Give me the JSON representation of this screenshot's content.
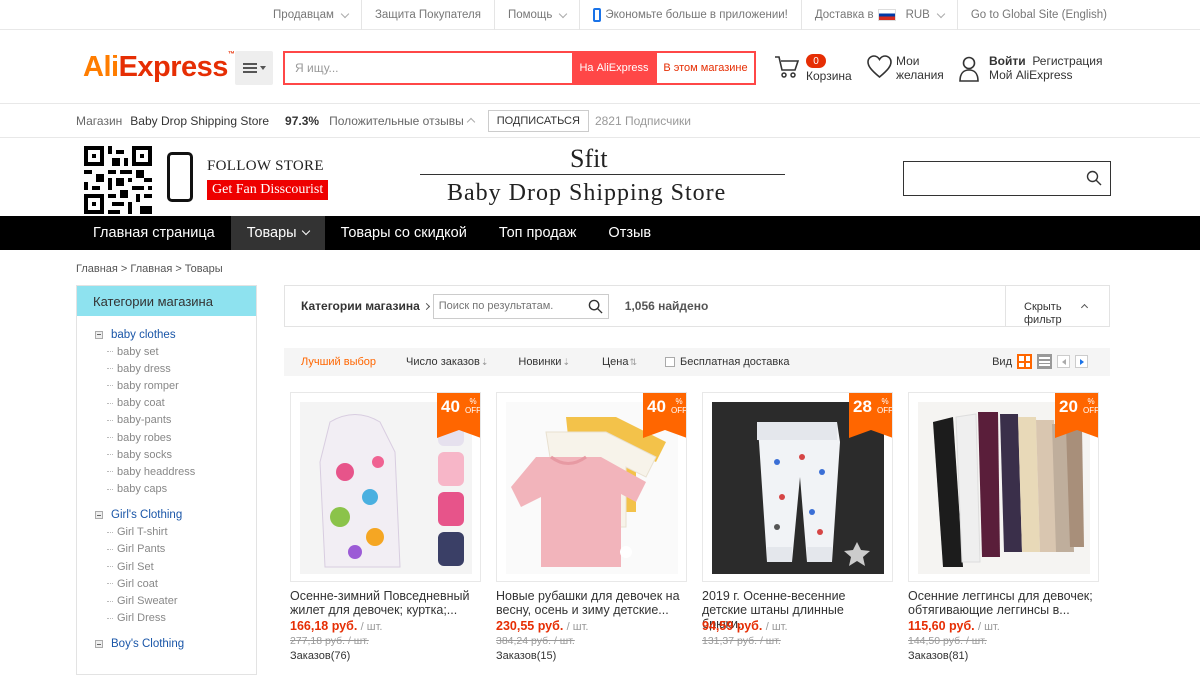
{
  "topbar": {
    "sellers": "Продавцам",
    "buyer_protection": "Защита Покупателя",
    "help": "Помощь",
    "app_promo": "Экономьте больше в приложении!",
    "delivery": "Доставка в",
    "currency": "RUB",
    "global_site": "Go to Global Site (English)"
  },
  "header": {
    "logo_ali": "Ali",
    "logo_express": "Express",
    "logo_tm": "™",
    "search_placeholder": "Я ищу...",
    "btn_aliexpress": "На AliExpress",
    "btn_store": "В этом магазине",
    "cart_count": "0",
    "cart_label": "Корзина",
    "wish_line1": "Мои",
    "wish_line2": "желания",
    "login": "Войти",
    "register": "Регистрация",
    "my_ali": "Мой AliExpress"
  },
  "storebar": {
    "store_label": "Магазин",
    "store_name": "Baby Drop Shipping Store",
    "rating": "97.3%",
    "feedback": "Положительные отзывы",
    "subscribe": "ПОДПИСАТЬСЯ",
    "subscribers": "2821 Подписчики"
  },
  "banner": {
    "follow": "FOLLOW STORE",
    "fan": "Get Fan Disscourist",
    "brand": "Sfit",
    "store_title": "Baby Drop Shipping Store"
  },
  "nav": {
    "items": [
      "Главная страница",
      "Товары",
      "Товары со скидкой",
      "Топ продаж",
      "Отзыв"
    ]
  },
  "breadcrumb": "Главная > Главная > Товары",
  "sidebar": {
    "title": "Категории магазина",
    "groups": [
      {
        "title": "baby clothes",
        "items": [
          "baby set",
          "baby dress",
          "baby romper",
          "baby coat",
          "baby-pants",
          "baby robes",
          "baby socks",
          "baby headdress",
          "baby caps"
        ]
      },
      {
        "title": "Girl's Clothing",
        "items": [
          "Girl T-shirt",
          "Girl Pants",
          "Girl Set",
          "Girl coat",
          "Girl Sweater",
          "Girl Dress"
        ]
      },
      {
        "title": "Boy's Clothing",
        "items": []
      }
    ]
  },
  "filter": {
    "categories": "Категории магазина",
    "search_placeholder": "Поиск по результатам.",
    "found": "1,056 найдено",
    "hide_line1": "Скрыть",
    "hide_line2": "фильтр"
  },
  "sort": {
    "best": "Лучший выбор",
    "orders": "Число заказов",
    "new": "Новинки",
    "price": "Цена",
    "free_shipping": "Бесплатная доставка",
    "view": "Вид"
  },
  "products": [
    {
      "discount": "40",
      "title": "Осенне-зимний Повседневный жилет для девочек; куртка;...",
      "price": "166,18 руб.",
      "unit": "/ шт.",
      "old": "277,18 руб. / шт.",
      "orders": "Заказов(76)"
    },
    {
      "discount": "40",
      "title": "Новые рубашки для девочек на весну, осень и зиму детские...",
      "price": "230,55 руб.",
      "unit": "/ шт.",
      "old": "384,24 руб. / шт.",
      "orders": "Заказов(15)"
    },
    {
      "discount": "28",
      "title": "2019 г. Осенне-весенние детские штаны длинные брюки...",
      "price": "94,59 руб.",
      "unit": "/ шт.",
      "old": "131,37 руб. / шт.",
      "orders": ""
    },
    {
      "discount": "20",
      "title": "Осенние леггинсы для девочек; обтягивающие леггинсы в...",
      "price": "115,60 руб.",
      "unit": "/ шт.",
      "old": "144,50 руб. / шт.",
      "orders": "Заказов(81)"
    }
  ],
  "badge_pct": "%",
  "badge_off": "OFF",
  "colors": {
    "accent": "#ff4747",
    "orange": "#ff6600",
    "sidebar_head": "#8ee2ef"
  }
}
